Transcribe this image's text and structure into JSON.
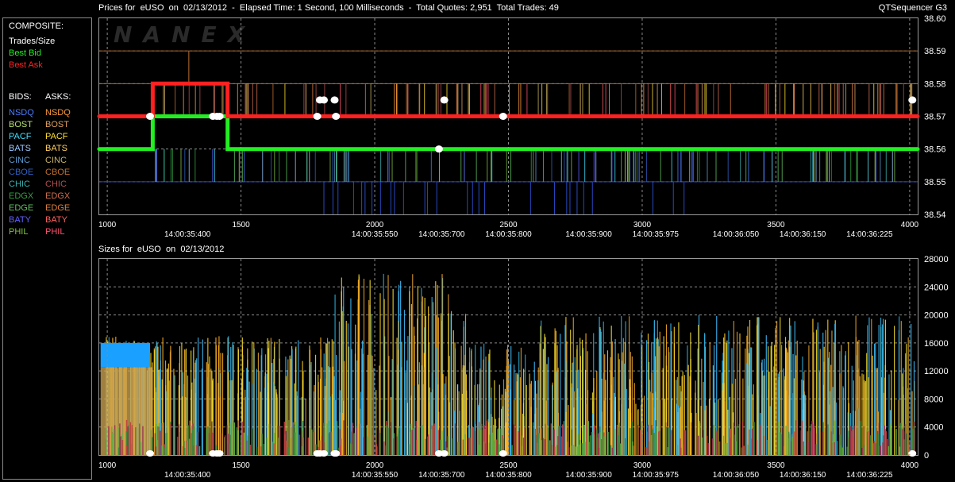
{
  "header": {
    "title": "Prices for  eUSO  on  02/13/2012  -  Elapsed Time: 1 Second, 100 Milliseconds  -  Total Quotes: 2,951  Total Trades: 49",
    "brand": "QTSequencer G3",
    "sizes_title": "Sizes for  eUSO  on  02/13/2012",
    "logo": "NANEX"
  },
  "legend": {
    "composite_label": "COMPOSITE:",
    "composite": [
      {
        "label": "Trades/Size",
        "color": "#ffffff"
      },
      {
        "label": "Best Bid",
        "color": "#22ee22"
      },
      {
        "label": "Best Ask",
        "color": "#ff2020"
      }
    ],
    "bids_label": "BIDS:",
    "asks_label": "ASKS:",
    "exchanges": [
      {
        "bid": "NSDQ",
        "ask": "NSDQ",
        "bid_color": "#4a7cff",
        "ask_color": "#ff9a3c"
      },
      {
        "bid": "BOST",
        "ask": "BOST",
        "bid_color": "#b4e070",
        "ask_color": "#e0a060"
      },
      {
        "bid": "PACF",
        "ask": "PACF",
        "bid_color": "#3ee0ff",
        "ask_color": "#ffe030"
      },
      {
        "bid": "BATS",
        "ask": "BATS",
        "bid_color": "#9ac8ff",
        "ask_color": "#ffd060"
      },
      {
        "bid": "CINC",
        "ask": "CINC",
        "bid_color": "#5a9ad0",
        "ask_color": "#c8b060"
      },
      {
        "bid": "CBOE",
        "ask": "CBOE",
        "bid_color": "#3060c0",
        "ask_color": "#c07030"
      },
      {
        "bid": "CHIC",
        "ask": "CHIC",
        "bid_color": "#3cb0b0",
        "ask_color": "#b05050"
      },
      {
        "bid": "EDGX",
        "ask": "EDGX",
        "bid_color": "#30a040",
        "ask_color": "#d07050"
      },
      {
        "bid": "EDGE",
        "ask": "EDGE",
        "bid_color": "#60c060",
        "ask_color": "#e08040"
      },
      {
        "bid": "BATY",
        "ask": "BATY",
        "bid_color": "#6060ff",
        "ask_color": "#ff6060"
      },
      {
        "bid": "PHIL",
        "ask": "PHIL",
        "bid_color": "#80c040",
        "ask_color": "#ff5070"
      }
    ]
  },
  "chart_data": [
    {
      "type": "line",
      "title": "Prices for  eUSO  on  02/13/2012",
      "x_ticks": [
        1000,
        1500,
        2000,
        2500,
        3000,
        3500,
        4000
      ],
      "time_labels": [
        {
          "x": 1300,
          "label": "14:00:35:400"
        },
        {
          "x": 2000,
          "label": "14:00:35:550"
        },
        {
          "x": 2250,
          "label": "14:00:35:700"
        },
        {
          "x": 2500,
          "label": "14:00:35:800"
        },
        {
          "x": 2800,
          "label": "14:00:35:900"
        },
        {
          "x": 3050,
          "label": "14:00:35:975"
        },
        {
          "x": 3350,
          "label": "14:00:36:050"
        },
        {
          "x": 3600,
          "label": "14:00:36:150"
        },
        {
          "x": 3850,
          "label": "14:00:36:225"
        }
      ],
      "y_ticks": [
        38.54,
        38.55,
        38.56,
        38.57,
        38.58,
        38.59,
        38.6
      ],
      "xlim": [
        970,
        4030
      ],
      "ylim": [
        38.54,
        38.6
      ],
      "series": [
        {
          "name": "Best Bid",
          "color": "#22ee22",
          "x": [
            970,
            1170,
            1170,
            1450,
            1450,
            4030
          ],
          "y": [
            38.56,
            38.56,
            38.57,
            38.57,
            38.56,
            38.56
          ]
        },
        {
          "name": "Best Ask",
          "color": "#ff2020",
          "x": [
            970,
            1170,
            1170,
            1450,
            1450,
            4030
          ],
          "y": [
            38.57,
            38.57,
            38.58,
            38.58,
            38.57,
            38.57
          ]
        }
      ],
      "trades": [
        {
          "x": 1160,
          "y": 38.57
        },
        {
          "x": 1395,
          "y": 38.57
        },
        {
          "x": 1410,
          "y": 38.57
        },
        {
          "x": 1420,
          "y": 38.57
        },
        {
          "x": 1785,
          "y": 38.57
        },
        {
          "x": 1795,
          "y": 38.575
        },
        {
          "x": 1810,
          "y": 38.575
        },
        {
          "x": 1850,
          "y": 38.575
        },
        {
          "x": 1855,
          "y": 38.57
        },
        {
          "x": 2240,
          "y": 38.56
        },
        {
          "x": 2260,
          "y": 38.575
        },
        {
          "x": 2480,
          "y": 38.57
        },
        {
          "x": 4010,
          "y": 38.575
        }
      ]
    },
    {
      "type": "bar",
      "title": "Sizes for  eUSO  on  02/13/2012",
      "x_ticks": [
        1000,
        1500,
        2000,
        2500,
        3000,
        3500,
        4000
      ],
      "y_ticks": [
        0,
        4000,
        8000,
        12000,
        16000,
        20000,
        24000,
        28000
      ],
      "xlim": [
        970,
        4030
      ],
      "ylim": [
        0,
        28000
      ]
    }
  ]
}
